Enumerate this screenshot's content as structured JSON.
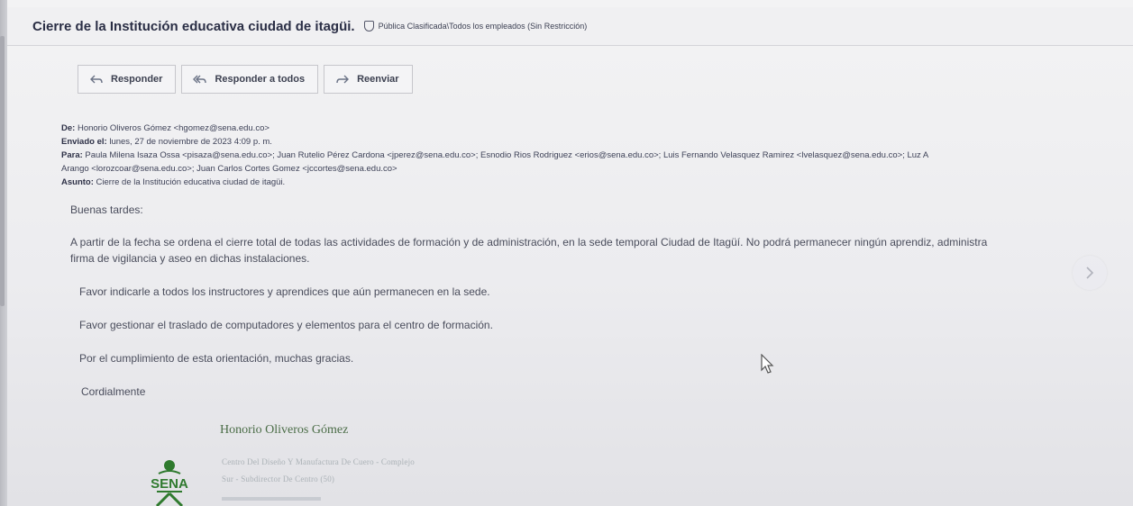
{
  "subject": {
    "title": "Cierre de la Institución educativa ciudad de itagüi.",
    "classification": "Pública Clasificada\\Todos los empleados (Sin Restricción)"
  },
  "toolbar": {
    "reply": "Responder",
    "reply_all": "Responder a todos",
    "forward": "Reenviar"
  },
  "headers": {
    "from_label": "De:",
    "from": "Honorio Oliveros Gómez <hgomez@sena.edu.co>",
    "sent_label": "Enviado el:",
    "sent": "lunes, 27 de noviembre de 2023 4:09 p. m.",
    "to_label": "Para:",
    "to_line1": "Paula Milena Isaza Ossa <pisaza@sena.edu.co>; Juan Rutelio Pérez Cardona <jperez@sena.edu.co>; Esnodio Rios Rodriguez <erios@sena.edu.co>; Luis Fernando Velasquez Ramirez <lvelasquez@sena.edu.co>; Luz A",
    "to_line2": "Arango <lorozcoar@sena.edu.co>; Juan Carlos Cortes Gomez <jccortes@sena.edu.co>",
    "subject_label": "Asunto:",
    "subject": "Cierre de la Institución educativa ciudad de itagüi."
  },
  "body": {
    "greeting": "Buenas tardes:",
    "p1_line1": "A partir de la fecha se ordena el cierre total de todas las actividades de formación y de administración, en la sede temporal Ciudad de Itagüí. No podrá  permanecer ningún aprendiz, administra",
    "p1_line2": "firma de vigilancia y aseo en dichas instalaciones.",
    "p2": "Favor indicarle a todos los instructores y aprendices que aún permanecen en la sede.",
    "p3": "Favor gestionar el traslado de computadores y elementos para el centro de formación.",
    "p4": "Por el cumplimiento de esta orientación, muchas gracias.",
    "closing": "Cordialmente"
  },
  "signature": {
    "name": "Honorio Oliveros Gómez",
    "line1": "Centro Del Diseño Y Manufactura De Cuero - Complejo",
    "line2": "Sur - Subdirector De Centro (50)",
    "logo_text": "SENA"
  },
  "colors": {
    "accent_text": "#2a2e45",
    "signature_green": "#4b6d47",
    "sena_green": "#39a900"
  },
  "icons": [
    "shield-icon",
    "reply-icon",
    "reply-all-icon",
    "forward-icon",
    "chevron-right-icon",
    "mouse-cursor-icon"
  ]
}
